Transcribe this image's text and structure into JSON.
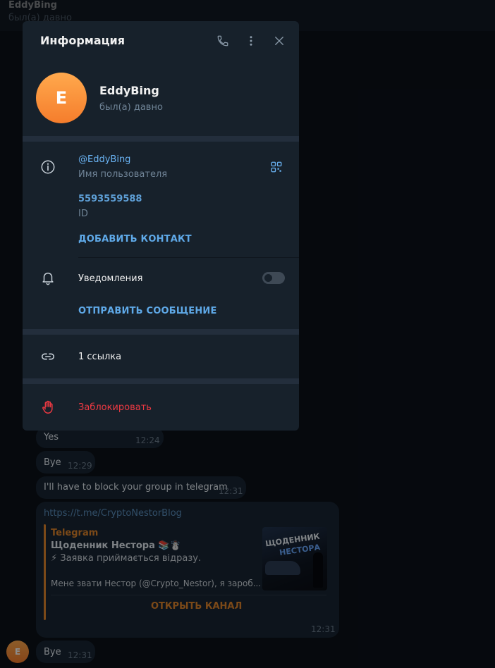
{
  "chat": {
    "header_title": "EddyBing",
    "header_status": "был(а) давно",
    "messages": [
      {
        "text": "Yes",
        "time": "12:24"
      },
      {
        "text": "Bye",
        "time": "12:29"
      },
      {
        "text": "I'll have to block your group in telegram",
        "time": "12:31"
      }
    ],
    "link_message": {
      "url": "https://t.me/CryptoNestorBlog",
      "site": "Telegram",
      "title": "Щоденник Нестора 📚☃️",
      "line1": "⚡ Заявка приймається відразу.",
      "line2": "Мене звати Нестор (@Crypto_Nestor), я зароб...",
      "button": "ОТКРЫТЬ КАНАЛ",
      "thumb_text_1": "ЩОДЕННИК",
      "thumb_text_2": "НЕСТОРА",
      "time": "12:31"
    },
    "last_message": {
      "avatar_letter": "E",
      "text": "Bye",
      "time": "12:31"
    }
  },
  "modal": {
    "title": "Информация",
    "icons": [
      "phone-icon",
      "more-icon",
      "close-icon"
    ],
    "user": {
      "avatar_letter": "E",
      "name": "EddyBing",
      "status": "был(а) давно"
    },
    "username": "@EddyBing",
    "username_label": "Имя пользователя",
    "id_value": "5593559588",
    "id_label": "ID",
    "add_contact": "ДОБАВИТЬ КОНТАКТ",
    "notifications_label": "Уведомления",
    "notifications_enabled": false,
    "send_message": "ОТПРАВИТЬ СООБЩЕНИЕ",
    "links_label": "1 ссылка",
    "block_label": "Заблокировать"
  },
  "colors": {
    "accent": "#6ab3f3",
    "danger": "#ec3942",
    "panel": "#17212b",
    "preview_accent": "#e0862c"
  }
}
